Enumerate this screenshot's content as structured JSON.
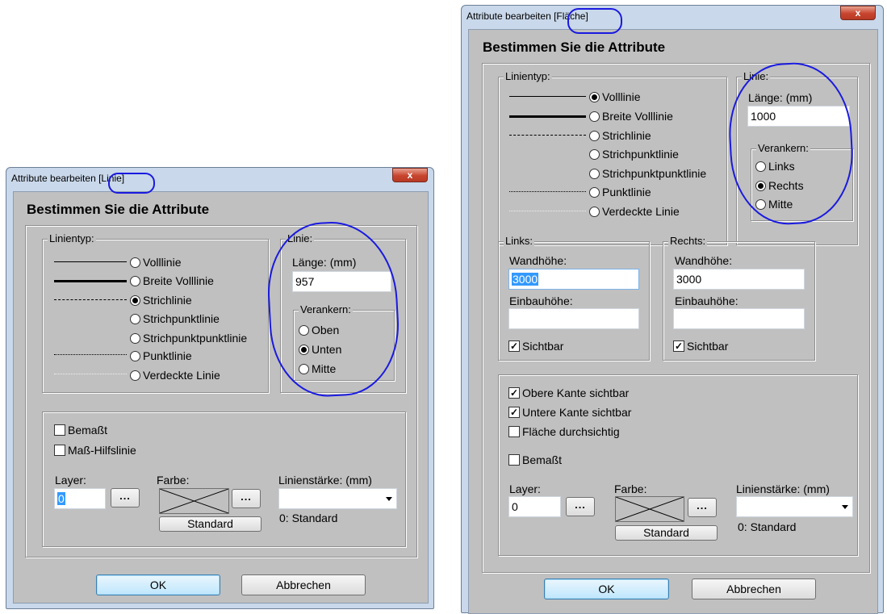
{
  "left": {
    "title_prefix": "Attribute bearbeiten",
    "title_tag": "[Linie]",
    "heading": "Bestimmen Sie die Attribute",
    "linientyp_label": "Linientyp:",
    "linientypes": [
      {
        "label": "Volllinie",
        "selected": false
      },
      {
        "label": "Breite Volllinie",
        "selected": false
      },
      {
        "label": "Strichlinie",
        "selected": true
      },
      {
        "label": "Strichpunktlinie",
        "selected": false
      },
      {
        "label": "Strichpunktpunktlinie",
        "selected": false
      },
      {
        "label": "Punktlinie",
        "selected": false
      },
      {
        "label": "Verdeckte Linie",
        "selected": false
      }
    ],
    "linie_label": "Linie:",
    "laenge_label": "Länge: (mm)",
    "laenge_value": "957",
    "verankern_label": "Verankern:",
    "verankern": [
      {
        "label": "Oben",
        "selected": false
      },
      {
        "label": "Unten",
        "selected": true
      },
      {
        "label": "Mitte",
        "selected": false
      }
    ],
    "bemasst_label": "Bemaßt",
    "bemasst_checked": false,
    "hilfslinie_label": "Maß-Hilfslinie",
    "hilfslinie_checked": false,
    "layer_label": "Layer:",
    "layer_value": "0",
    "browse_label": "...",
    "farbe_label": "Farbe:",
    "standard_button": "Standard",
    "linienstaerke_label": "Linienstärke: (mm)",
    "linienstaerke_value": "",
    "linienstaerke_note": "0: Standard",
    "ok_button": "OK",
    "cancel_button": "Abbrechen",
    "close_glyph": "x"
  },
  "right": {
    "title_prefix": "Attribute bearbeiten",
    "title_tag": "[Fläche]",
    "heading": "Bestimmen Sie die Attribute",
    "linientyp_label": "Linientyp:",
    "linientypes": [
      {
        "label": "Volllinie",
        "selected": true
      },
      {
        "label": "Breite Volllinie",
        "selected": false
      },
      {
        "label": "Strichlinie",
        "selected": false
      },
      {
        "label": "Strichpunktlinie",
        "selected": false
      },
      {
        "label": "Strichpunktpunktlinie",
        "selected": false
      },
      {
        "label": "Punktlinie",
        "selected": false
      },
      {
        "label": "Verdeckte Linie",
        "selected": false
      }
    ],
    "linie_label": "Linie:",
    "laenge_label": "Länge: (mm)",
    "laenge_value": "1000",
    "verankern_label": "Verankern:",
    "verankern": [
      {
        "label": "Links",
        "selected": false
      },
      {
        "label": "Rechts",
        "selected": true
      },
      {
        "label": "Mitte",
        "selected": false
      }
    ],
    "links": {
      "group_label": "Links:",
      "wandhoehe_label": "Wandhöhe:",
      "wandhoehe_value": "3000",
      "einbauhoehe_label": "Einbauhöhe:",
      "einbauhoehe_value": "",
      "sichtbar_label": "Sichtbar",
      "sichtbar_checked": true
    },
    "rechts": {
      "group_label": "Rechts:",
      "wandhoehe_label": "Wandhöhe:",
      "wandhoehe_value": "3000",
      "einbauhoehe_label": "Einbauhöhe:",
      "einbauhoehe_value": "",
      "sichtbar_label": "Sichtbar",
      "sichtbar_checked": true
    },
    "obere_label": "Obere Kante sichtbar",
    "obere_checked": true,
    "untere_label": "Untere Kante sichtbar",
    "untere_checked": true,
    "flaeche_label": "Fläche durchsichtig",
    "flaeche_checked": false,
    "bemasst_label": "Bemaßt",
    "bemasst_checked": false,
    "layer_label": "Layer:",
    "layer_value": "0",
    "browse_label": "...",
    "farbe_label": "Farbe:",
    "standard_button": "Standard",
    "linienstaerke_label": "Linienstärke: (mm)",
    "linienstaerke_value": "",
    "linienstaerke_note": "0: Standard",
    "ok_button": "OK",
    "cancel_button": "Abbrechen",
    "close_glyph": "x"
  },
  "colors": {
    "annotation": "#1a1ae0",
    "frame": "#c9d8ea",
    "client": "#c0c0c0",
    "selection": "#3399ff"
  }
}
